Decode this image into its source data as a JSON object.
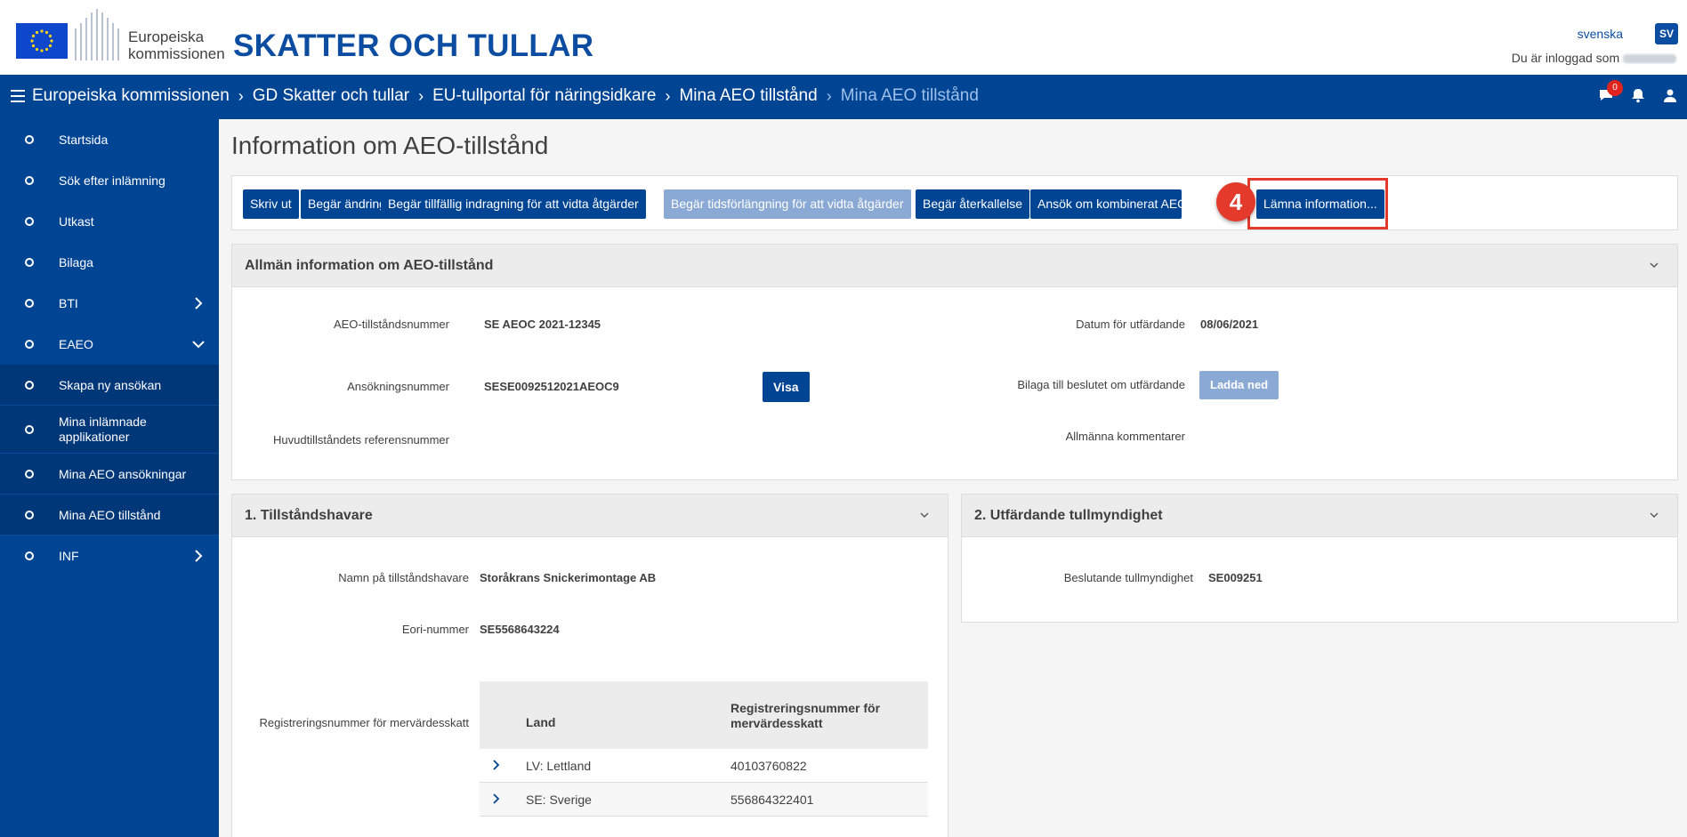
{
  "header": {
    "logo_line1": "Europeiska",
    "logo_line2": "kommissionen",
    "site_title": "SKATTER OCH TULLAR",
    "language": "svenska",
    "language_code": "SV",
    "logged_in_text": "Du är inloggad som"
  },
  "breadcrumb": {
    "items": [
      "Europeiska kommissionen",
      "GD Skatter och tullar",
      "EU-tullportal för näringsidkare",
      "Mina AEO tillstånd"
    ],
    "current": "Mina AEO tillstånd",
    "notification_count": "0"
  },
  "sidebar": {
    "items": [
      {
        "label": "Startsida"
      },
      {
        "label": "Sök efter inlämning"
      },
      {
        "label": "Utkast"
      },
      {
        "label": "Bilaga"
      },
      {
        "label": "BTI"
      },
      {
        "label": "EAEO"
      },
      {
        "label": "Skapa ny ansökan"
      },
      {
        "label": "Mina inlämnade applikationer"
      },
      {
        "label": "Mina AEO ansökningar"
      },
      {
        "label": "Mina AEO tillstånd"
      },
      {
        "label": "INF"
      }
    ]
  },
  "page": {
    "title": "Information om AEO-tillstånd",
    "step_number": "4"
  },
  "actions": {
    "print": "Skriv ut",
    "request_change": "Begär ändring",
    "request_suspension": "Begär tillfällig indragning för att vidta åtgärder",
    "request_extension": "Begär tidsförlängning för att vidta åtgärder",
    "request_revocation": "Begär återkallelse",
    "apply_combined": "Ansök om kombinerat AEO-till",
    "submit_info": "Lämna information..."
  },
  "general": {
    "title": "Allmän information om AEO-tillstånd",
    "auth_number_label": "AEO-tillståndsnummer",
    "auth_number": "SE AEOC 2021-12345",
    "application_number_label": "Ansökningsnummer",
    "application_number": "SESE0092512021AEOC9",
    "view_button": "Visa",
    "main_ref_label": "Huvudtillståndets referensnummer",
    "issue_date_label": "Datum för utfärdande",
    "issue_date": "08/06/2021",
    "attachment_label": "Bilaga till beslutet om utfärdande",
    "download_button": "Ladda ned",
    "comments_label": "Allmänna kommentarer"
  },
  "holder": {
    "title": "1. Tillståndshavare",
    "name_label": "Namn på tillståndshavare",
    "name": "Storåkrans Snickerimontage AB",
    "eori_label": "Eori-nummer",
    "eori": "SE5568643224",
    "vat_label": "Registreringsnummer för mervärdesskatt",
    "vat_headers": {
      "country": "Land",
      "number_line1": "Registreringsnummer för",
      "number_line2": "mervärdesskatt"
    },
    "vat_rows": [
      {
        "country": "LV: Lettland",
        "number": "40103760822"
      },
      {
        "country": "SE: Sverige",
        "number": "556864322401"
      }
    ]
  },
  "authority": {
    "title": "2. Utfärdande tullmyndighet",
    "deciding_label": "Beslutande tullmyndighet",
    "deciding_value": "SE009251"
  },
  "colors": {
    "primary": "#004494",
    "title_blue": "#0c4da2",
    "highlight": "#e33a2c",
    "disabled": "#8aa9d4"
  }
}
